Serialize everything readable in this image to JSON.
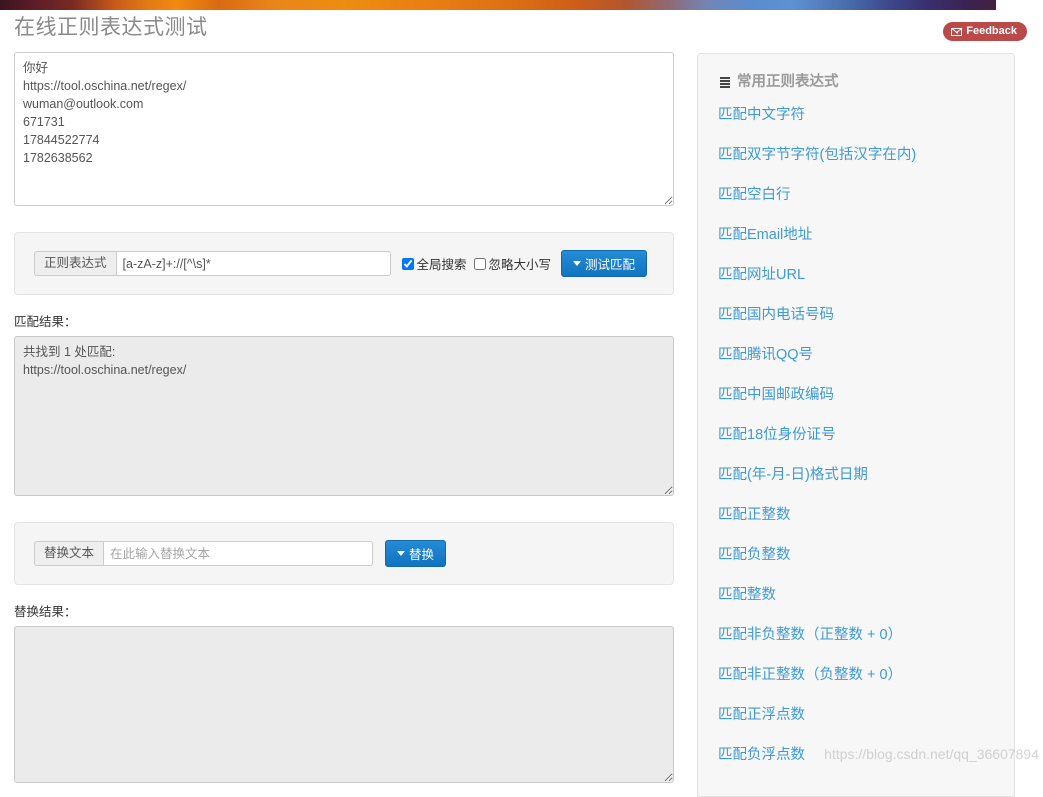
{
  "topbar": {
    "accent_colors": [
      "#3d1420",
      "#ee8d10",
      "#5b8ccd",
      "#3b2350"
    ]
  },
  "header": {
    "title": "在线正则表达式测试",
    "feedback_label": "Feedback",
    "feedback_color": "#b94a48"
  },
  "source": {
    "text": "你好\nhttps://tool.oschina.net/regex/\nwuman@outlook.com\n671731\n17844522774\n1782638562"
  },
  "regex_form": {
    "label": "正则表达式",
    "value": "[a-zA-z]+://[^\\s]*",
    "global_label": "全局搜索",
    "global_checked": true,
    "ignorecase_label": "忽略大小写",
    "ignorecase_checked": false,
    "test_button": "测试匹配"
  },
  "match": {
    "label": "匹配结果：",
    "text": "共找到 1 处匹配:\nhttps://tool.oschina.net/regex/"
  },
  "replace_form": {
    "label": "替换文本",
    "value": "",
    "placeholder": "在此输入替换文本",
    "replace_button": "替换"
  },
  "replace_result": {
    "label": "替换结果：",
    "text": ""
  },
  "sidebar": {
    "title": "常用正则表达式",
    "icon": "list-icon",
    "link_color": "#3d9ad6",
    "items": [
      {
        "label": "匹配中文字符"
      },
      {
        "label": "匹配双字节字符(包括汉字在内)"
      },
      {
        "label": "匹配空白行"
      },
      {
        "label": "匹配Email地址"
      },
      {
        "label": "匹配网址URL"
      },
      {
        "label": "匹配国内电话号码"
      },
      {
        "label": "匹配腾讯QQ号"
      },
      {
        "label": "匹配中国邮政编码"
      },
      {
        "label": "匹配18位身份证号"
      },
      {
        "label": "匹配(年-月-日)格式日期"
      },
      {
        "label": "匹配正整数"
      },
      {
        "label": "匹配负整数"
      },
      {
        "label": "匹配整数"
      },
      {
        "label": "匹配非负整数（正整数 + 0）"
      },
      {
        "label": "匹配非正整数（负整数 + 0）"
      },
      {
        "label": "匹配正浮点数"
      },
      {
        "label": "匹配负浮点数"
      }
    ]
  },
  "watermark": {
    "text": "https://blog.csdn.net/qq_36607894"
  }
}
